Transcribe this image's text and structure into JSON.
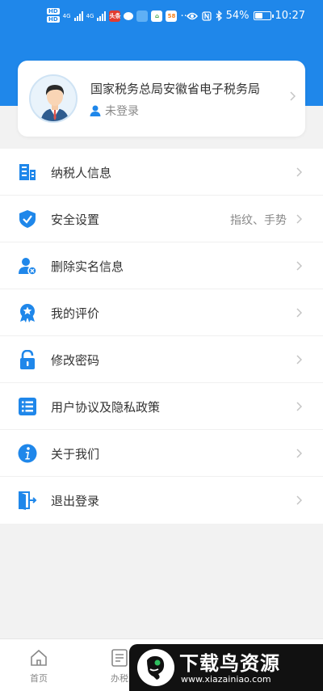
{
  "status_bar": {
    "network_badges": [
      "HD",
      "HD"
    ],
    "network_labels": [
      "4G",
      "4G"
    ],
    "app_badges": [
      "头条",
      "58"
    ],
    "more": "···",
    "battery_percent": "54%",
    "battery_level": 0.54,
    "time": "10:27"
  },
  "profile": {
    "name": "国家税务总局安徽省电子税务局",
    "login_status": "未登录"
  },
  "menu": [
    {
      "label": "纳税人信息",
      "value": "",
      "icon": "building-icon"
    },
    {
      "label": "安全设置",
      "value": "指纹、手势",
      "icon": "shield-icon"
    },
    {
      "label": "删除实名信息",
      "value": "",
      "icon": "user-remove-icon"
    },
    {
      "label": "我的评价",
      "value": "",
      "icon": "badge-star-icon"
    },
    {
      "label": "修改密码",
      "value": "",
      "icon": "lock-icon"
    },
    {
      "label": "用户协议及隐私政策",
      "value": "",
      "icon": "list-icon"
    },
    {
      "label": "关于我们",
      "value": "",
      "icon": "info-icon"
    },
    {
      "label": "退出登录",
      "value": "",
      "icon": "exit-icon"
    }
  ],
  "tabs": [
    {
      "label": "首页",
      "icon": "home-icon"
    },
    {
      "label": "办税",
      "icon": "document-icon"
    }
  ],
  "watermark": {
    "title": "下载鸟资源",
    "url": "www.xiazainiao.com"
  },
  "colors": {
    "primary": "#1f87ea",
    "background": "#f2f2f2"
  }
}
